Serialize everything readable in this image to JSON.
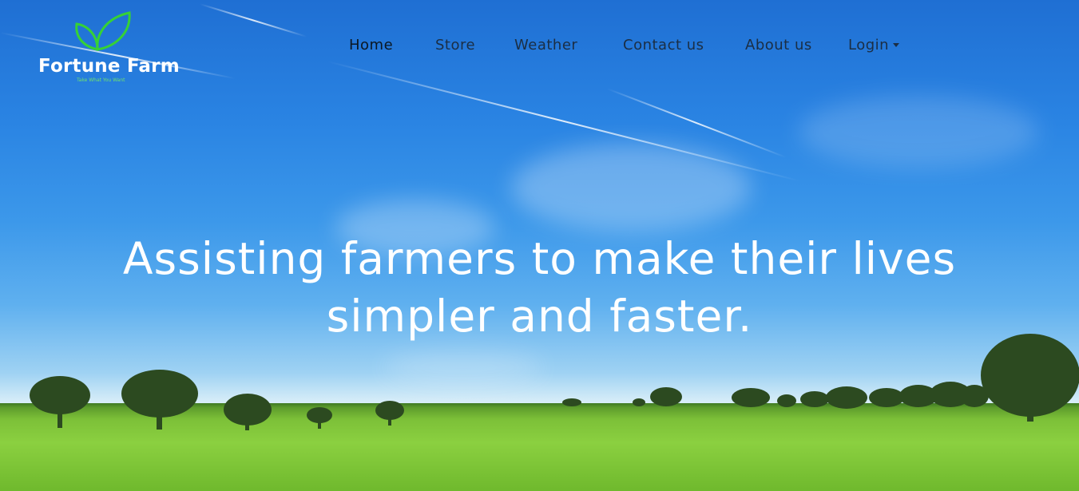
{
  "logo": {
    "title": "Fortune Farm",
    "tagline": "Take What You Want",
    "icon": "leaf-icon"
  },
  "nav": {
    "items": [
      {
        "label": "Home",
        "active": true
      },
      {
        "label": "Store"
      },
      {
        "label": "Weather"
      },
      {
        "label": "Contact us"
      },
      {
        "label": "About us"
      },
      {
        "label": "Login",
        "dropdown": true
      }
    ]
  },
  "hero": {
    "headline_line1": "Assisting farmers to make their lives",
    "headline_line2": "simpler and faster."
  },
  "colors": {
    "accent": "#2ecc40",
    "nav_text": "#1b2e44",
    "headline": "#ffffff",
    "sky": "#2a84e3",
    "field": "#7cc038"
  }
}
